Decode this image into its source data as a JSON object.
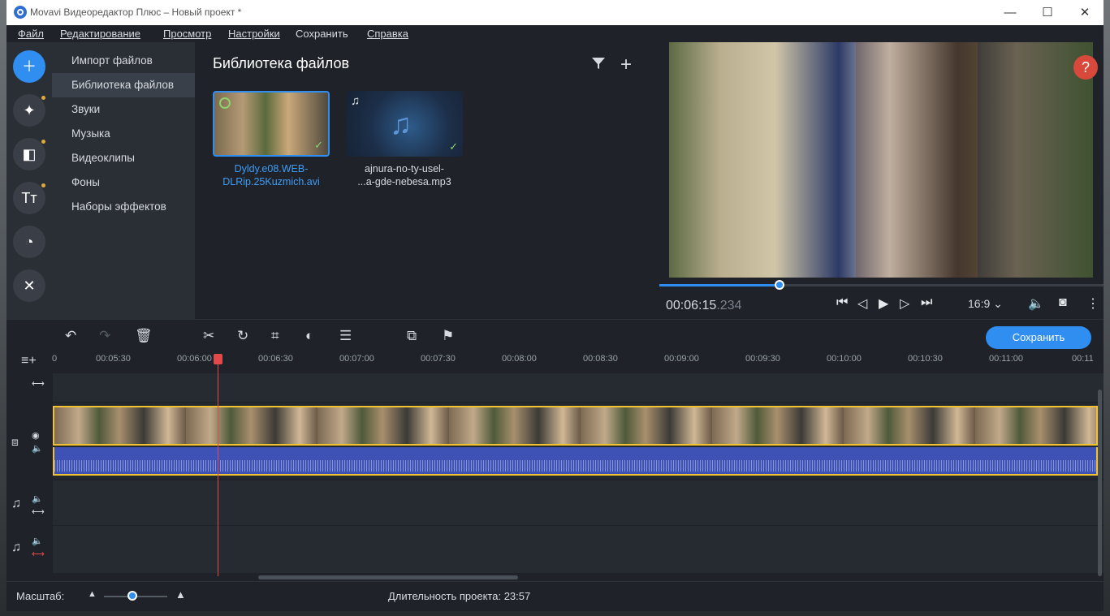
{
  "window": {
    "title": "Movavi Видеоредактор Плюс – Новый проект *"
  },
  "menu": [
    "Файл",
    "Редактирование",
    "Просмотр",
    "Настройки",
    "Сохранить",
    "Справка"
  ],
  "side_nav": [
    "Импорт файлов",
    "Библиотека файлов",
    "Звуки",
    "Музыка",
    "Видеоклипы",
    "Фоны",
    "Наборы эффектов"
  ],
  "library": {
    "title": "Библиотека файлов",
    "files": [
      {
        "name": "Dyldy.e08.WEB-DLRip.25Kuzmich.avi",
        "line1": "Dyldy.e08.WEB-",
        "line2": "DLRip.25Kuzmich.avi",
        "type": "video",
        "selected": true
      },
      {
        "name": "ajnura-no-ty-usel-...a-gde-nebesa.mp3",
        "line1": "ajnura-no-ty-usel-",
        "line2": "...a-gde-nebesa.mp3",
        "type": "audio",
        "selected": false
      }
    ]
  },
  "preview": {
    "help": "?",
    "timecode_main": "00:06:15",
    "timecode_ms": ".234",
    "progress": 0.27,
    "aspect_ratio": "16:9 ⌄"
  },
  "toolbar": {
    "save_label": "Сохранить"
  },
  "timeline": {
    "ruler_ticks": [
      "0",
      "00:05:30",
      "00:06:00",
      "00:06:30",
      "00:07:00",
      "00:07:30",
      "00:08:00",
      "00:08:30",
      "00:09:00",
      "00:09:30",
      "00:10:00",
      "00:10:30",
      "00:11:00",
      "00:11"
    ]
  },
  "status": {
    "zoom_label": "Масштаб:",
    "duration_label": "Длительность проекта:",
    "duration_value": "23:57"
  },
  "colors": {
    "accent": "#2f8ef0",
    "clip_border": "#f2c230",
    "playhead": "#e24a4a",
    "help": "#d9493b"
  }
}
